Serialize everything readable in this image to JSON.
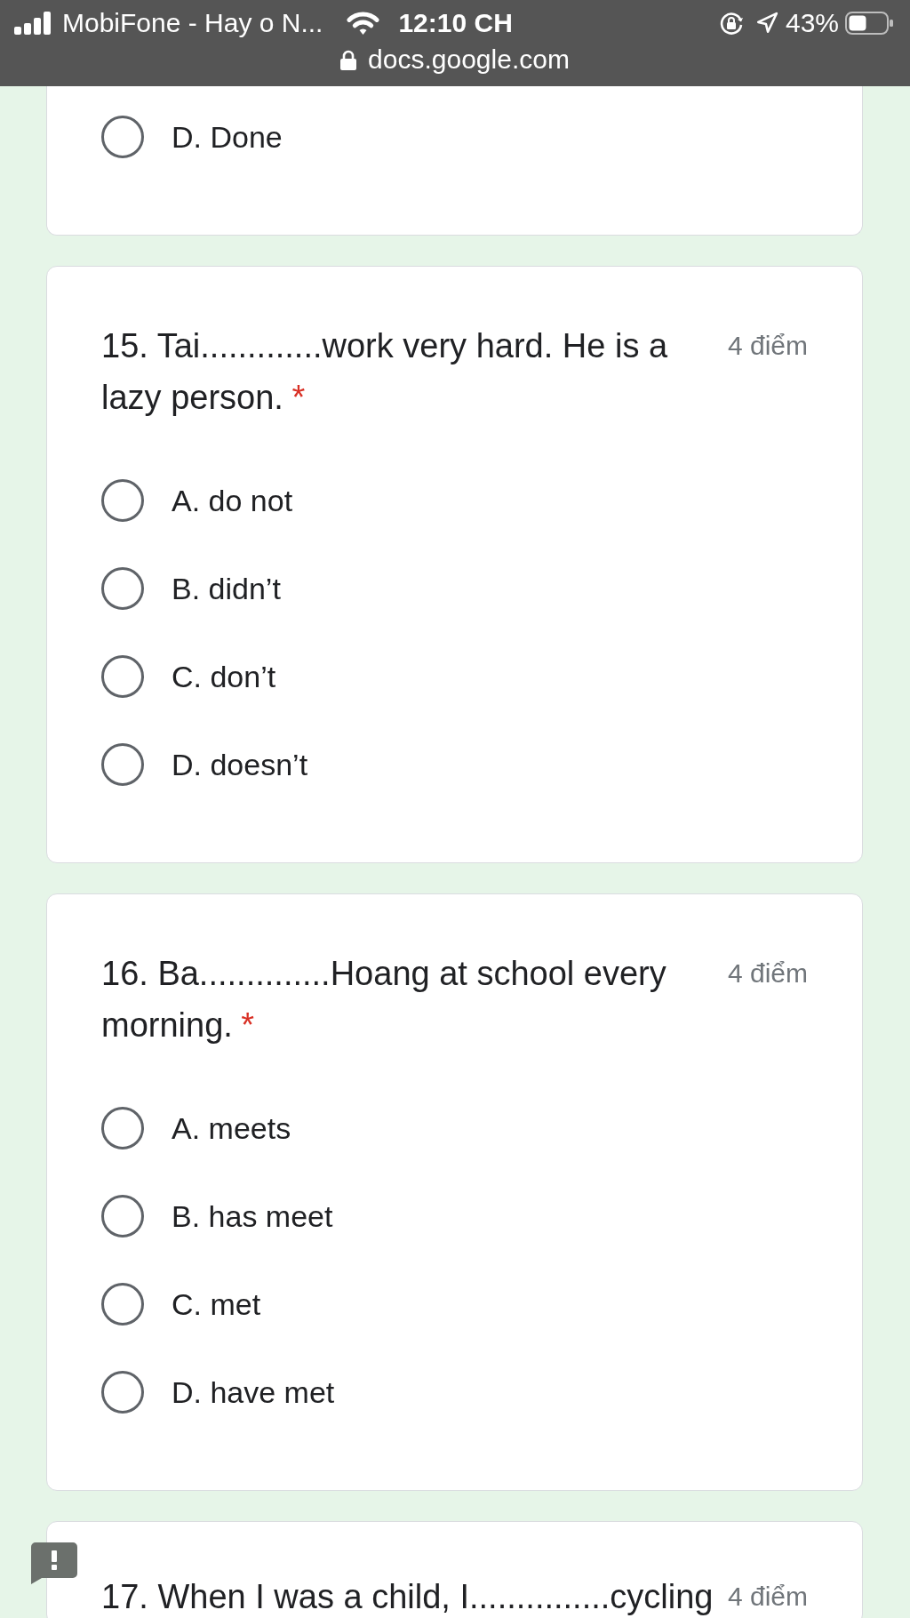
{
  "status_bar": {
    "carrier": "MobiFone - Hay o N...",
    "time": "12:10 CH",
    "battery": "43%",
    "url": "docs.google.com"
  },
  "questions": [
    {
      "options": [
        {
          "label": "D. Done",
          "selected": false
        }
      ]
    },
    {
      "title": "15. Tai.............work very hard. He is a lazy person.",
      "required_mark": "*",
      "points": "4 điểm",
      "options": [
        {
          "label": "A. do not",
          "selected": false
        },
        {
          "label": "B. didn’t",
          "selected": false
        },
        {
          "label": "C. don’t",
          "selected": false
        },
        {
          "label": "D. doesn’t",
          "selected": false
        }
      ]
    },
    {
      "title": "16. Ba..............Hoang at school every morning.",
      "required_mark": "*",
      "points": "4 điểm",
      "options": [
        {
          "label": "A. meets",
          "selected": false
        },
        {
          "label": "B. has meet",
          "selected": false
        },
        {
          "label": "C. met",
          "selected": false
        },
        {
          "label": "D. have met",
          "selected": false
        }
      ]
    },
    {
      "title": "17. When I was a child, I...............cycling",
      "points": "4 điểm"
    }
  ]
}
